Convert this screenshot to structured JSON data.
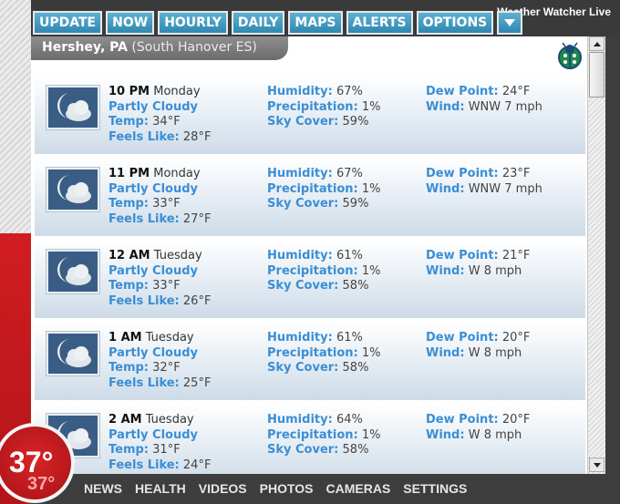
{
  "app_title": "Weather Watcher Live",
  "nav": [
    "UPDATE",
    "NOW",
    "HOURLY",
    "DAILY",
    "MAPS",
    "ALERTS",
    "OPTIONS"
  ],
  "location": {
    "name": "Hershey, PA",
    "station": "(South Hanover ES)"
  },
  "labels": {
    "temp": "Temp:",
    "feels": "Feels Like:",
    "humidity": "Humidity:",
    "precip": "Precipitation:",
    "sky": "Sky Cover:",
    "dew": "Dew Point:",
    "wind": "Wind:"
  },
  "hours": [
    {
      "time": "10 PM",
      "day": "Monday",
      "condition": "Partly Cloudy",
      "temp": "34°F",
      "feels": "28°F",
      "humidity": "67%",
      "precip": "1%",
      "sky": "59%",
      "dew": "24°F",
      "wind": "WNW 7 mph"
    },
    {
      "time": "11 PM",
      "day": "Monday",
      "condition": "Partly Cloudy",
      "temp": "33°F",
      "feels": "27°F",
      "humidity": "67%",
      "precip": "1%",
      "sky": "59%",
      "dew": "23°F",
      "wind": "WNW 7 mph"
    },
    {
      "time": "12 AM",
      "day": "Tuesday",
      "condition": "Partly Cloudy",
      "temp": "33°F",
      "feels": "26°F",
      "humidity": "61%",
      "precip": "1%",
      "sky": "58%",
      "dew": "21°F",
      "wind": "W 8 mph"
    },
    {
      "time": "1 AM",
      "day": "Tuesday",
      "condition": "Partly Cloudy",
      "temp": "32°F",
      "feels": "25°F",
      "humidity": "61%",
      "precip": "1%",
      "sky": "58%",
      "dew": "20°F",
      "wind": "W 8 mph"
    },
    {
      "time": "2 AM",
      "day": "Tuesday",
      "condition": "Partly Cloudy",
      "temp": "31°F",
      "feels": "24°F",
      "humidity": "64%",
      "precip": "1%",
      "sky": "58%",
      "dew": "20°F",
      "wind": "W 8 mph"
    }
  ],
  "current": {
    "temp": "37°",
    "feels": "37°"
  },
  "bottom_nav": [
    "NEWS",
    "HEALTH",
    "VIDEOS",
    "PHOTOS",
    "CAMERAS",
    "SETTINGS"
  ],
  "colors": {
    "accent": "#3b8ed4",
    "nav_button": "#3c95bd",
    "temp_red": "#c81d22"
  }
}
